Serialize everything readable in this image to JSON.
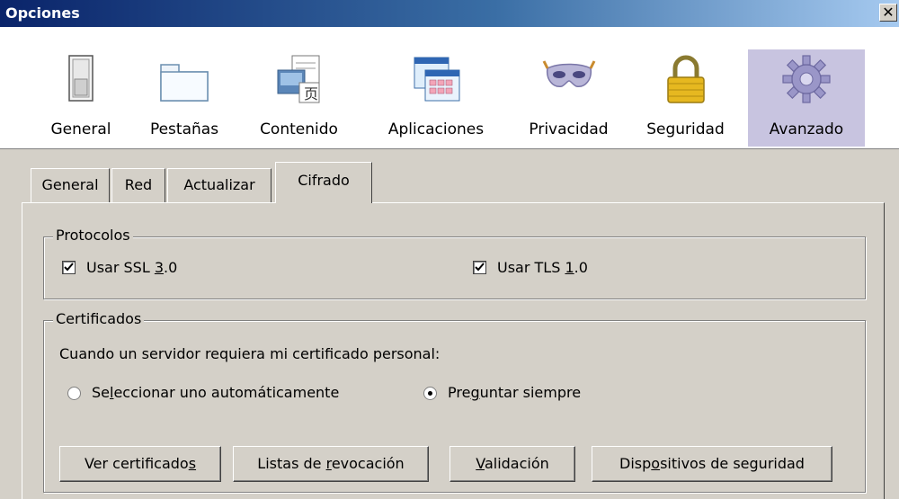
{
  "window": {
    "title": "Opciones",
    "close": "✕"
  },
  "panes": [
    {
      "id": "general",
      "label": "General",
      "icon": "switch-icon"
    },
    {
      "id": "tabs",
      "label": "Pestañas",
      "icon": "folder-tab-icon"
    },
    {
      "id": "content",
      "label": "Contenido",
      "icon": "content-icon"
    },
    {
      "id": "apps",
      "label": "Aplicaciones",
      "icon": "calendar-window-icon"
    },
    {
      "id": "privacy",
      "label": "Privacidad",
      "icon": "mask-icon"
    },
    {
      "id": "security",
      "label": "Seguridad",
      "icon": "padlock-icon"
    },
    {
      "id": "advanced",
      "label": "Avanzado",
      "icon": "gear-icon",
      "active": true
    }
  ],
  "tabs": [
    {
      "label": "General"
    },
    {
      "label": "Red"
    },
    {
      "label": "Actualizar"
    },
    {
      "label": "Cifrado",
      "active": true
    }
  ],
  "protocols": {
    "legend": "Protocolos",
    "ssl": {
      "pre": "Usar SSL ",
      "accel": "3",
      "post": ".0",
      "checked": true
    },
    "tls": {
      "pre": "Usar TLS ",
      "accel": "1",
      "post": ".0",
      "checked": true
    }
  },
  "certs": {
    "legend": "Certificados",
    "prompt": "Cuando un servidor requiera mi certificado personal:",
    "auto": {
      "pre": "Se",
      "accel": "l",
      "post": "eccionar uno automáticamente",
      "selected": false
    },
    "ask": {
      "pre": "Pre",
      "accel": "g",
      "post": "untar siempre",
      "selected": true
    },
    "buttons": {
      "view": {
        "pre": "Ver certificado",
        "accel": "s",
        "post": ""
      },
      "revocation": {
        "pre": "Listas de ",
        "accel": "r",
        "post": "evocación"
      },
      "validation": {
        "pre": "",
        "accel": "V",
        "post": "alidación"
      },
      "devices": {
        "pre": "Disp",
        "accel": "o",
        "post": "sitivos de seguridad"
      }
    }
  },
  "colors": {
    "accent": "#0a246a",
    "active_pane": "#c8c4e0",
    "face": "#d4d0c8"
  }
}
